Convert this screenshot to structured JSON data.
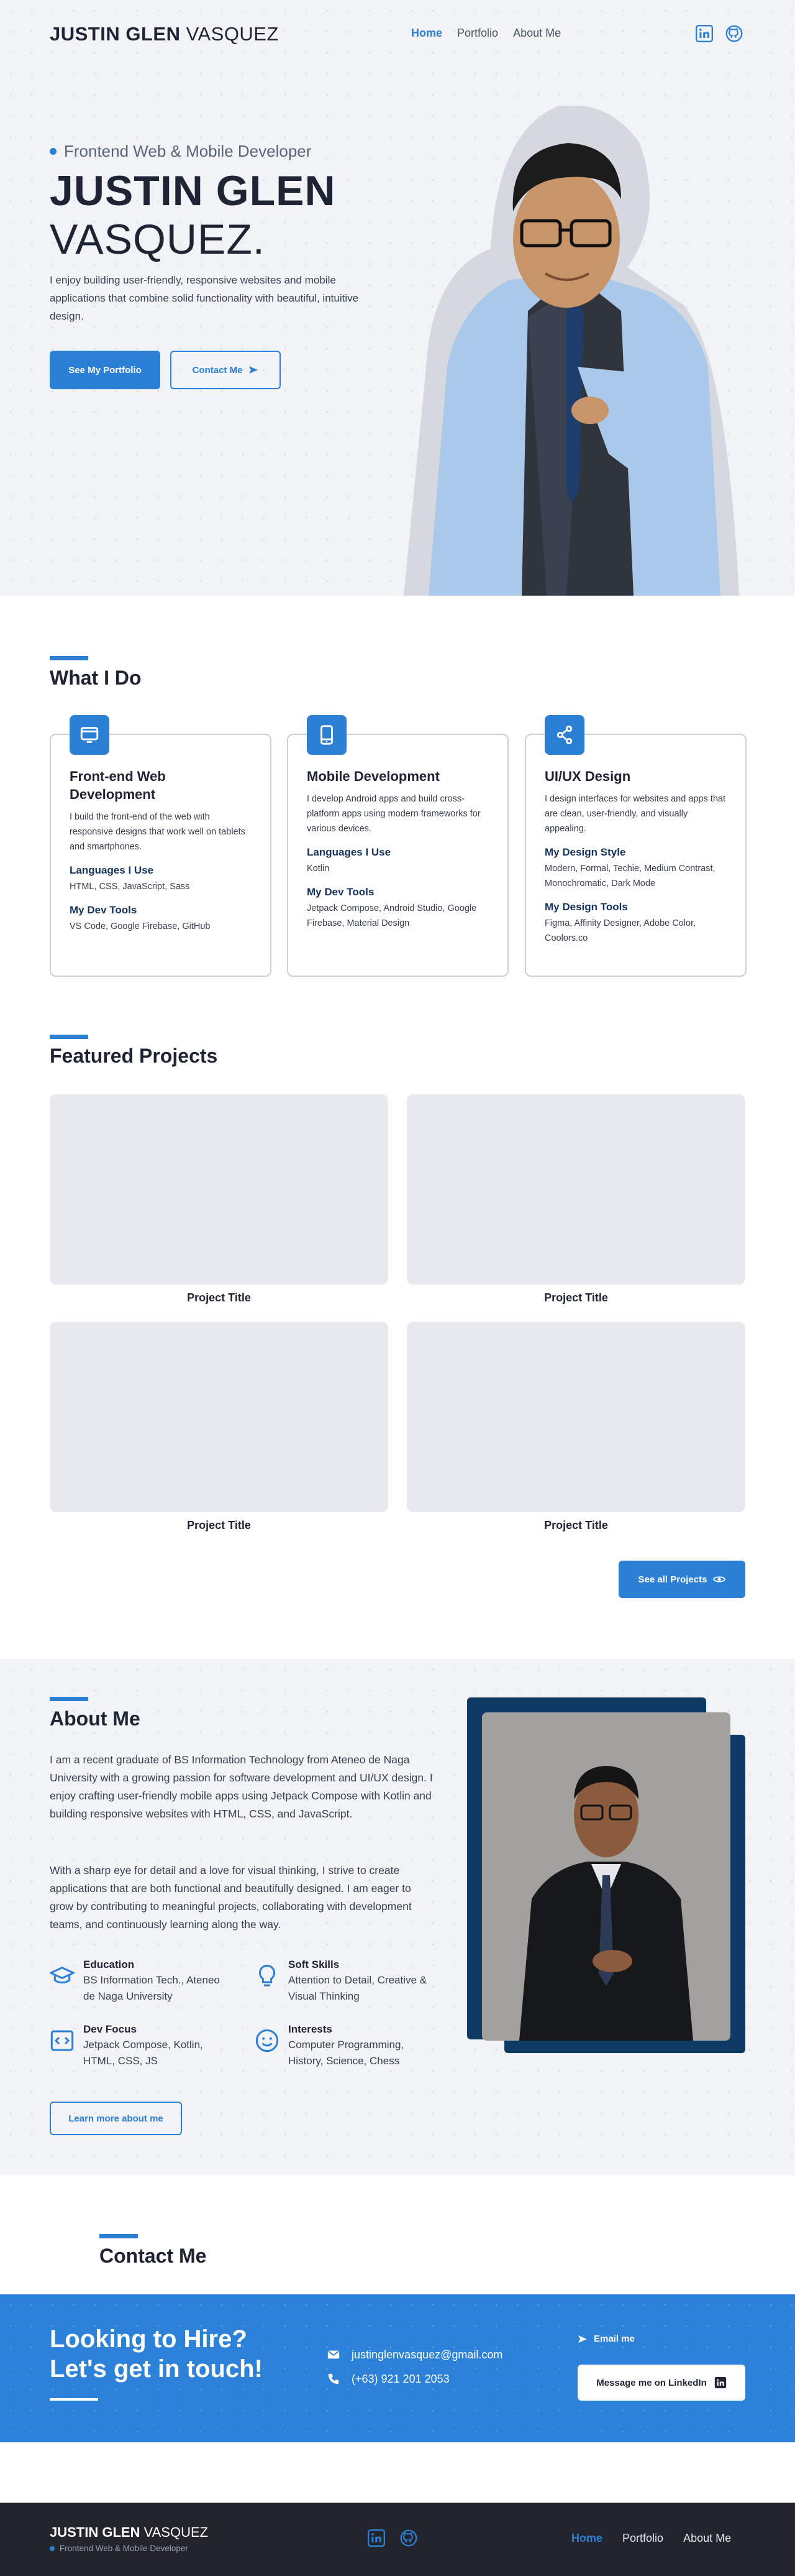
{
  "header": {
    "brand_bold": "JUSTIN GLEN",
    "brand_light": "VASQUEZ",
    "nav": [
      {
        "label": "Home",
        "active": true
      },
      {
        "label": "Portfolio",
        "active": false
      },
      {
        "label": "About Me",
        "active": false
      }
    ],
    "social": [
      "linkedin-icon",
      "github-icon"
    ]
  },
  "hero": {
    "kicker": "Frontend Web & Mobile Developer",
    "name_line1": "JUSTIN GLEN",
    "name_line2": "VASQUEZ.",
    "description": "I enjoy building user-friendly, responsive websites and mobile applications that combine solid functionality with beautiful, intuitive design.",
    "primary_button": "See My Portfolio",
    "secondary_button": "Contact Me"
  },
  "what_i_do": {
    "title": "What I Do",
    "cards": [
      {
        "icon": "monitor-icon",
        "title": "Front-end Web Development",
        "description": "I build the front-end of the web with responsive designs that work well on tablets and smartphones.",
        "h1": "Languages I Use",
        "t1": "HTML, CSS, JavaScript, Sass",
        "h2": "My Dev Tools",
        "t2": "VS Code, Google Firebase, GitHub"
      },
      {
        "icon": "phone-icon",
        "title": "Mobile Development",
        "description": "I develop Android apps and build cross-platform apps using modern frameworks for various devices.",
        "h1": "Languages I Use",
        "t1": "Kotlin",
        "h2": "My Dev Tools",
        "t2": "Jetpack Compose, Android Studio, Google Firebase, Material Design"
      },
      {
        "icon": "share-icon",
        "title": "UI/UX Design",
        "description": "I design interfaces for websites and apps that are clean, user-friendly, and visually appealing.",
        "h1": "My Design Style",
        "t1": "Modern, Formal, Techie, Medium Contrast, Monochromatic, Dark Mode",
        "h2": "My Design Tools",
        "t2": "Figma, Affinity Designer, Adobe Color, Coolors.co"
      }
    ]
  },
  "projects": {
    "title": "Featured Projects",
    "items": [
      {
        "title": "Project Title"
      },
      {
        "title": "Project Title"
      },
      {
        "title": "Project Title"
      },
      {
        "title": "Project Title"
      }
    ],
    "button": "See all Projects"
  },
  "about": {
    "title": "About Me",
    "p1": "I am a recent graduate of BS Information Technology from Ateneo de Naga University with a growing passion for software development and UI/UX design. I enjoy crafting user-friendly mobile apps using Jetpack Compose with Kotlin and building responsive websites with HTML, CSS, and JavaScript.",
    "p2": "With a sharp eye for detail and a love for visual thinking, I strive to create applications that are both functional and beautifully designed. I am eager to grow by contributing to meaningful projects, collaborating with development teams, and continuously learning along the way.",
    "facts": [
      {
        "icon": "graduation-cap-icon",
        "label": "Education",
        "text": "BS Information Tech., Ateneo de Naga University"
      },
      {
        "icon": "lightbulb-icon",
        "label": "Soft Skills",
        "text": "Attention to Detail, Creative & Visual Thinking"
      },
      {
        "icon": "code-icon",
        "label": "Dev Focus",
        "text": "Jetpack Compose, Kotlin, HTML, CSS, JS"
      },
      {
        "icon": "smile-icon",
        "label": "Interests",
        "text": "Computer Programming, History, Science, Chess"
      }
    ],
    "button": "Learn more about me"
  },
  "contact": {
    "title": "Contact Me",
    "hire_line1": "Looking to Hire?",
    "hire_line2": "Let's get in touch!",
    "email": "justinglenvasquez@gmail.com",
    "phone": "(+63) 921 201 2053",
    "email_me": "Email me",
    "linkedin_button": "Message me on LinkedIn"
  },
  "footer": {
    "brand_bold": "JUSTIN GLEN",
    "brand_light": "VASQUEZ",
    "tagline": "Frontend Web & Mobile Developer",
    "nav": [
      {
        "label": "Home",
        "active": true
      },
      {
        "label": "Portfolio",
        "active": false
      },
      {
        "label": "About Me",
        "active": false
      }
    ]
  },
  "colors": {
    "accent": "#2b7fd4",
    "dark": "#1e2433",
    "navy": "#0f3a63",
    "footer": "#22252e"
  }
}
